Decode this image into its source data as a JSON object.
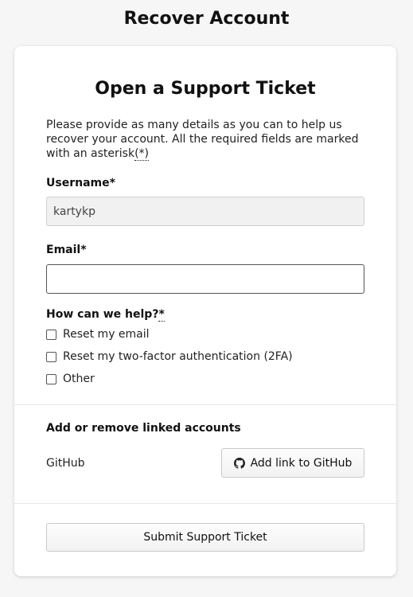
{
  "header": {
    "title": "Recover Account"
  },
  "form": {
    "title": "Open a Support Ticket",
    "intro_text": "Please provide as many details as you can to help us recover your account. All the required fields are marked with an asterisk",
    "intro_asterisk": "(*)",
    "username_label": "Username*",
    "username_value": "kartykp",
    "email_label": "Email*",
    "email_value": "",
    "help_label": "How can we help?",
    "help_asterisk": "*",
    "options": [
      {
        "label": "Reset my email",
        "checked": false
      },
      {
        "label": "Reset my two-factor authentication (2FA)",
        "checked": false
      },
      {
        "label": "Other",
        "checked": false
      }
    ]
  },
  "linked_accounts": {
    "heading": "Add or remove linked accounts",
    "provider_label": "GitHub",
    "add_button_label": "Add link to GitHub",
    "button_icon": "github-icon"
  },
  "submit": {
    "label": "Submit Support Ticket"
  }
}
